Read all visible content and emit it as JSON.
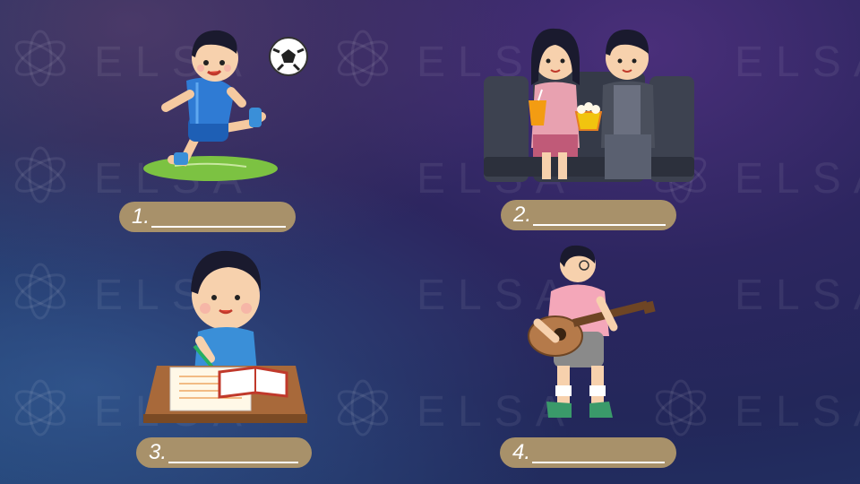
{
  "watermark": {
    "text": "ELSA"
  },
  "exercises": [
    {
      "number": "1.",
      "scene": "boy-kicking-soccer-ball"
    },
    {
      "number": "2.",
      "scene": "couple-at-movie-theater"
    },
    {
      "number": "3.",
      "scene": "boy-writing-homework"
    },
    {
      "number": "4.",
      "scene": "boy-playing-guitar"
    }
  ],
  "colors": {
    "label_bg": "#a8916a",
    "label_text": "#ffffff",
    "background": "#2d2660"
  }
}
